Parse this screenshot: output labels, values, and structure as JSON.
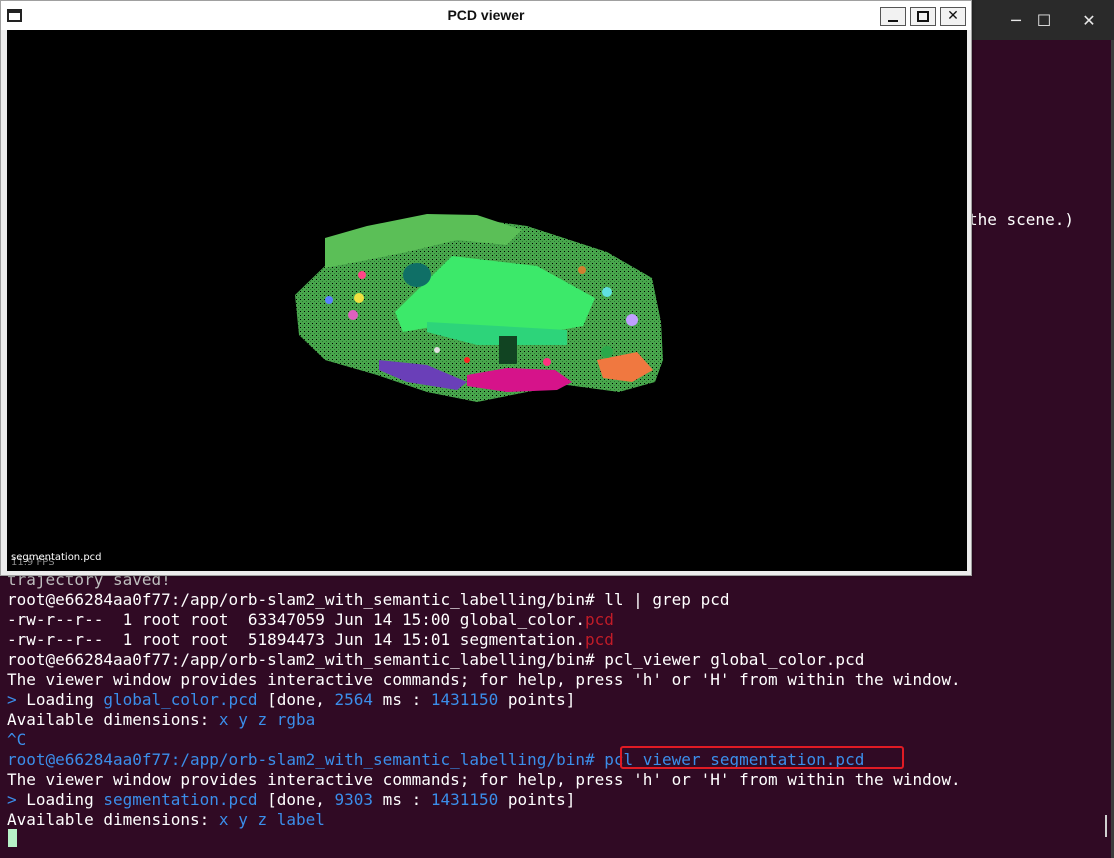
{
  "terminal": {
    "partial_text": "the scene.)",
    "lines": {
      "l0": "trajectory saved!",
      "l1_prompt": "root@e66284aa0f77:/app/orb-slam2_with_semantic_labelling/bin#",
      "l1_cmd": " ll | grep pcd",
      "l2_prefix": "-rw-r--r--  1 root root  63347059 Jun 14 15:00 global_color.",
      "l2_ext": "pcd",
      "l3_prefix": "-rw-r--r--  1 root root  51894473 Jun 14 15:01 segmentation.",
      "l3_ext": "pcd",
      "l4_prompt": "root@e66284aa0f77:/app/orb-slam2_with_semantic_labelling/bin#",
      "l4_cmd": " pcl_viewer global_color.pcd",
      "l5": "The viewer window provides interactive commands; for help, press 'h' or 'H' from within the window.",
      "l6_a": "> ",
      "l6_b": "Loading ",
      "l6_file": "global_color.pcd",
      "l6_c": " [done, ",
      "l6_ms": "2564",
      "l6_d": " ms : ",
      "l6_pts": "1431150",
      "l6_e": " points]",
      "l7_a": "Available dimensions: ",
      "l7_dims": "x y z rgba",
      "l8": "^C",
      "l9_prompt": "root@e66284aa0f77:/app/orb-slam2_with_semantic_labelling/bin#",
      "l9_cmd": " pcl_viewer segmentation.pcd",
      "l10": "The viewer window provides interactive commands; for help, press 'h' or 'H' from within the window.",
      "l11_a": "> ",
      "l11_b": "Loading ",
      "l11_file": "segmentation.pcd",
      "l11_c": " [done, ",
      "l11_ms": "9303",
      "l11_d": " ms : ",
      "l11_pts": "1431150",
      "l11_e": " points]",
      "l12_a": "Available dimensions: ",
      "l12_dims": "x y z label"
    }
  },
  "pcd_viewer": {
    "title": "PCD viewer",
    "filename_label": "segmentation.pcd",
    "fps_label": "11.9 FPS",
    "close_glyph": "✕"
  },
  "term_controls": {
    "min": "─",
    "max": "☐",
    "close": "✕"
  },
  "colors": {
    "terminal_bg": "#300a24",
    "link_blue": "#3b8eea",
    "ext_red": "#c01c28",
    "highlight_box": "#e01b24",
    "cloud_green": "#4caf50",
    "cloud_bright_green": "#3ce96a",
    "cloud_magenta": "#d6138a",
    "cloud_purple": "#6a3fb8"
  }
}
